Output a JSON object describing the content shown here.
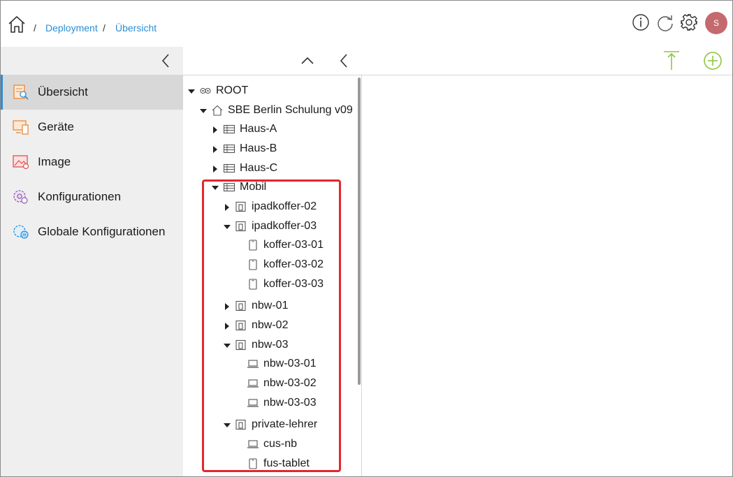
{
  "breadcrumb": {
    "separator": "/",
    "items": [
      "Deployment",
      "Übersicht"
    ]
  },
  "header": {
    "icons": [
      "info-icon",
      "refresh-icon",
      "gear-icon"
    ],
    "avatar_initial": "S",
    "avatar_color": "#c46a6f"
  },
  "sidebar": {
    "items": [
      {
        "label": "Übersicht",
        "icon": "overview-icon",
        "active": true
      },
      {
        "label": "Geräte",
        "icon": "devices-icon",
        "active": false
      },
      {
        "label": "Image",
        "icon": "image-icon",
        "active": false
      },
      {
        "label": "Konfigurationen",
        "icon": "config-icon",
        "active": false
      },
      {
        "label": "Globale Konfigurationen",
        "icon": "global-config-icon",
        "active": false
      }
    ]
  },
  "tree": {
    "nodes": [
      {
        "label": "ROOT",
        "icon": "root-icon",
        "caret": "down"
      },
      {
        "label": "SBE Berlin Schulung v09",
        "icon": "house-icon",
        "caret": "down"
      },
      {
        "label": "Haus-A",
        "icon": "building-icon",
        "caret": "right"
      },
      {
        "label": "Haus-B",
        "icon": "building-icon",
        "caret": "right"
      },
      {
        "label": "Haus-C",
        "icon": "building-icon",
        "caret": "right"
      },
      {
        "label": "Mobil",
        "icon": "building-icon",
        "caret": "down"
      },
      {
        "label": "ipadkoffer-02",
        "icon": "group-icon",
        "caret": "right"
      },
      {
        "label": "ipadkoffer-03",
        "icon": "group-icon",
        "caret": "down"
      },
      {
        "label": "koffer-03-01",
        "icon": "tablet-icon",
        "caret": ""
      },
      {
        "label": "koffer-03-02",
        "icon": "tablet-icon",
        "caret": ""
      },
      {
        "label": "koffer-03-03",
        "icon": "tablet-icon",
        "caret": ""
      },
      {
        "label": "nbw-01",
        "icon": "group-icon",
        "caret": "right"
      },
      {
        "label": "nbw-02",
        "icon": "group-icon",
        "caret": "right"
      },
      {
        "label": "nbw-03",
        "icon": "group-icon",
        "caret": "down"
      },
      {
        "label": "nbw-03-01",
        "icon": "laptop-icon",
        "caret": ""
      },
      {
        "label": "nbw-03-02",
        "icon": "laptop-icon",
        "caret": ""
      },
      {
        "label": "nbw-03-03",
        "icon": "laptop-icon",
        "caret": ""
      },
      {
        "label": "private-lehrer",
        "icon": "group-icon",
        "caret": "down"
      },
      {
        "label": "cus-nb",
        "icon": "laptop-icon",
        "caret": ""
      },
      {
        "label": "fus-tablet",
        "icon": "tablet-icon",
        "caret": ""
      }
    ]
  },
  "colors": {
    "link": "#2b8ed6",
    "accent_green": "#8cc63f",
    "highlight_red": "#e3272e"
  }
}
